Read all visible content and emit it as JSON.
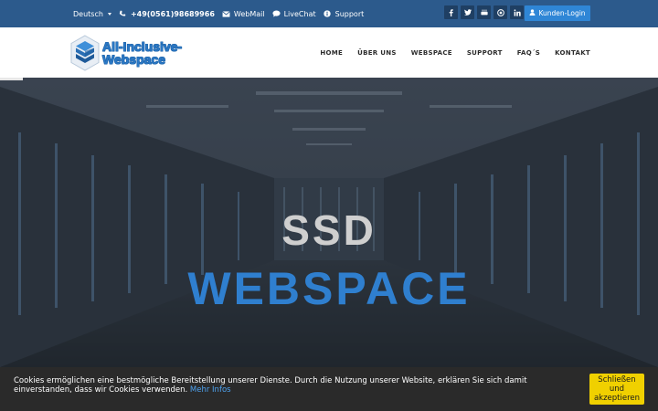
{
  "topbar": {
    "language": "Deutsch",
    "phone": "+49(0561)98689966",
    "webmail": "WebMail",
    "livechat": "LiveChat",
    "support": "Support",
    "social": [
      "f",
      "t",
      "yt",
      "ig",
      "in"
    ],
    "login": "Kunden-Login"
  },
  "logo": {
    "line1": "All-Inclusive-",
    "line2": "Webspace"
  },
  "nav": {
    "items": [
      "HOME",
      "ÜBER UNS",
      "WEBSPACE",
      "SUPPORT",
      "FAQ´S",
      "KONTAKT"
    ]
  },
  "hero": {
    "line1": "SSD",
    "line2": "WEBSPACE"
  },
  "cookie": {
    "message": "Cookies ermöglichen eine bestmögliche Bereitstellung unserer Dienste. Durch die Nutzung unserer Website, erklären Sie sich damit einverstanden, dass wir Cookies verwenden.",
    "link": "Mehr Infos",
    "button": "Schließen und akzeptieren"
  },
  "colors": {
    "topbar": "#2c5a8c",
    "accent": "#2f86d6",
    "cookie_button": "#f0d000"
  }
}
